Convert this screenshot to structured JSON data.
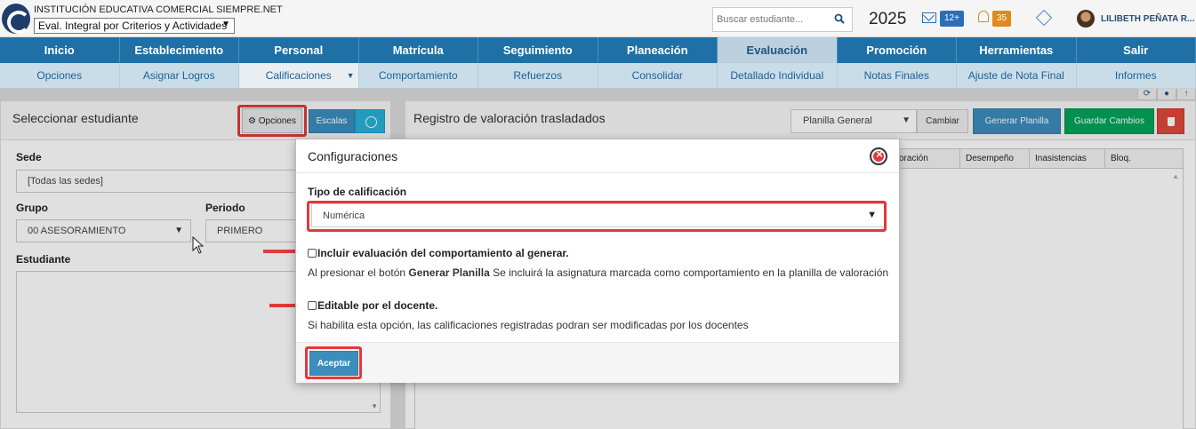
{
  "header": {
    "institution_name": "INSTITUCIÓN EDUCATIVA COMERCIAL SIEMPRE.NET",
    "module_select": "Eval. Integral por Criterios y Actividades",
    "search_placeholder": "Buscar estudiante...",
    "year": "2025",
    "mail_badge": "12+",
    "notifications_badge": "35",
    "user_name": "LILIBETH PEÑATA R..."
  },
  "nav_main": [
    {
      "label": "Inicio"
    },
    {
      "label": "Establecimiento"
    },
    {
      "label": "Personal"
    },
    {
      "label": "Matrícula"
    },
    {
      "label": "Seguimiento"
    },
    {
      "label": "Planeación"
    },
    {
      "label": "Evaluación"
    },
    {
      "label": "Promoción"
    },
    {
      "label": "Herramientas"
    },
    {
      "label": "Salir"
    }
  ],
  "nav_sub": [
    {
      "label": "Opciones"
    },
    {
      "label": "Asignar Logros"
    },
    {
      "label": "Calificaciones"
    },
    {
      "label": "Comportamiento"
    },
    {
      "label": "Refuerzos"
    },
    {
      "label": "Consolidar"
    },
    {
      "label": "Detallado Individual"
    },
    {
      "label": "Notas Finales"
    },
    {
      "label": "Ajuste de Nota Final"
    },
    {
      "label": "Informes"
    }
  ],
  "left_panel": {
    "title": "Seleccionar estudiante",
    "opciones_button": "Opciones",
    "escalas_button": "Escalas",
    "sede_label": "Sede",
    "sede_value": "[Todas las sedes]",
    "grupo_label": "Grupo",
    "grupo_value": "00 ASESORAMIENTO",
    "periodo_label": "Periodo",
    "periodo_value": "PRIMERO",
    "estudiante_label": "Estudiante"
  },
  "right_panel": {
    "title": "Registro de valoración trasladados",
    "planilla_select": "Planilla General",
    "cambiar_button": "Cambiar",
    "generar_button": "Generar Planilla",
    "guardar_button": "Guardar Cambios",
    "columns": [
      "oración",
      "Desempeño",
      "Inasistencias",
      "Bloq. Docentes"
    ]
  },
  "modal": {
    "title": "Configuraciones",
    "tipo_label": "Tipo de calificación",
    "tipo_value": "Numérica",
    "check1_label": "Incluir evaluación del comportamiento al generar.",
    "help1_prefix": "Al presionar el botón ",
    "help1_bold": "Generar Planilla",
    "help1_suffix": " Se incluirá la asignatura marcada como comportamiento en la planilla de valoración",
    "check2_label": "Editable por el docente.",
    "help2": "Si habilita esta opción, las calificaciones registradas podran ser modificadas por los docentes",
    "accept_button": "Aceptar"
  },
  "colors": {
    "nav_primary": "#1e70a6",
    "nav_secondary": "#c9dde9",
    "highlight": "#e03a3a",
    "button_primary": "#3c8dbc",
    "button_success": "#00a65a",
    "button_danger": "#dd4b39"
  }
}
